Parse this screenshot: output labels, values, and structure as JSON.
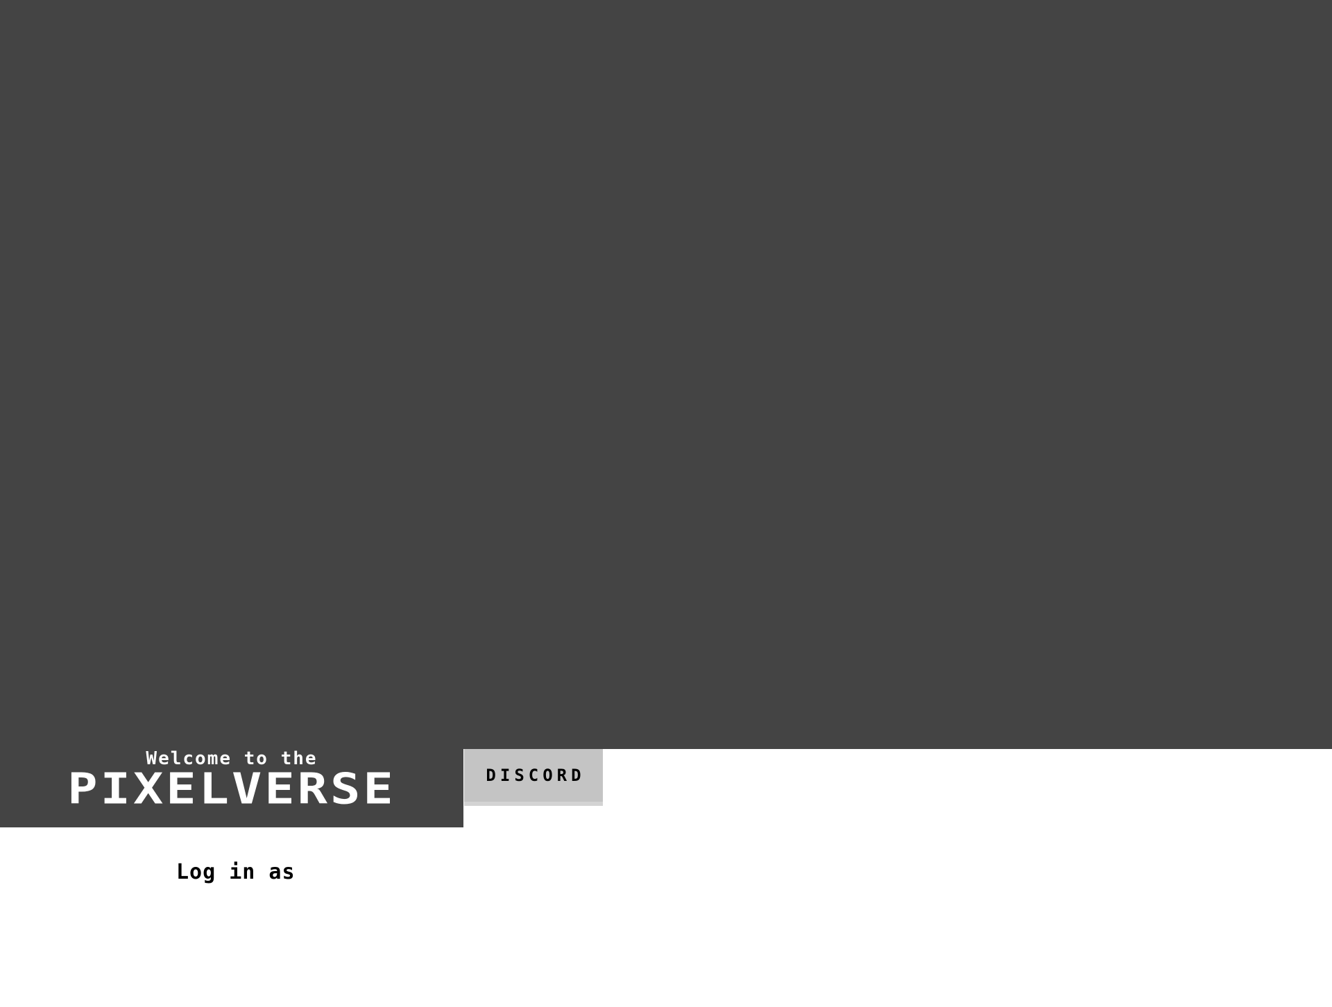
{
  "banner": {
    "welcome_text": "Welcome to the",
    "brand_text": "PIXELVERSE"
  },
  "toolbar": {
    "discord_label": "DISCORD"
  },
  "login": {
    "label": "Log in as"
  },
  "colors": {
    "canvas_background": "#444444",
    "banner_background": "#444444",
    "banner_text": "#ffffff",
    "discord_button_background": "#c4c4c4",
    "page_background": "#ffffff"
  }
}
